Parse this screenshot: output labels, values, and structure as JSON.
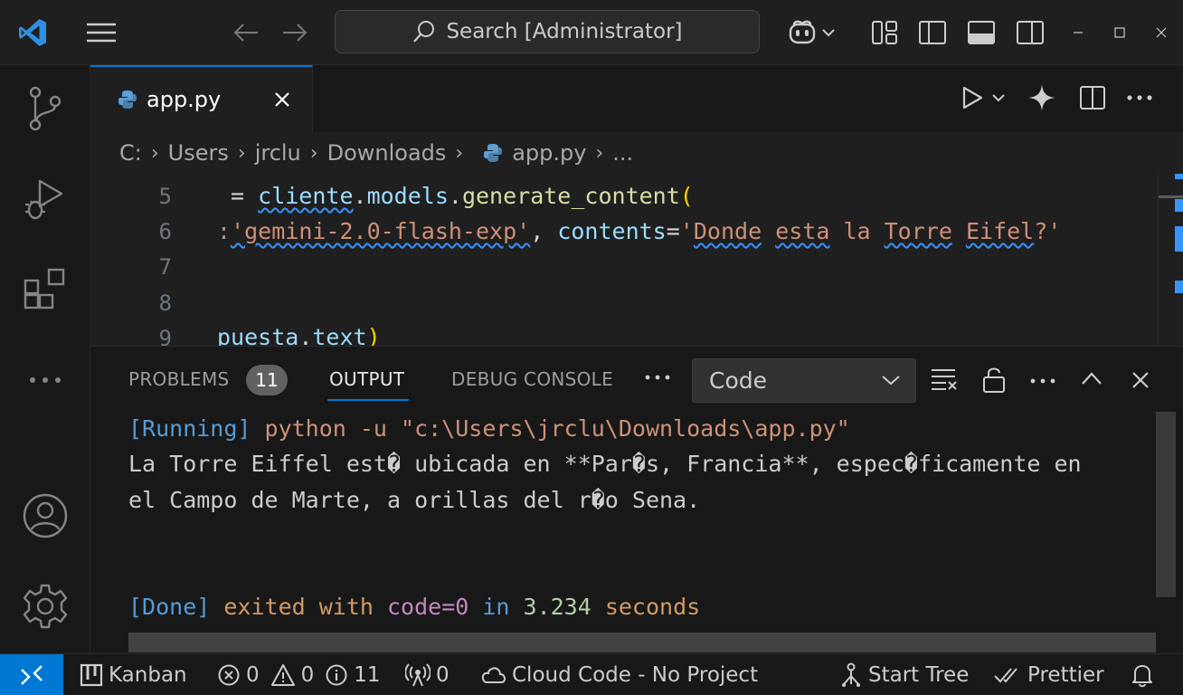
{
  "titlebar": {
    "search_text": "Search [Administrator]"
  },
  "tab": {
    "filename": "app.py"
  },
  "breadcrumb": [
    "C:",
    "Users",
    "jrclu",
    "Downloads",
    "app.py",
    "..."
  ],
  "editor": {
    "line_numbers": [
      "5",
      "6",
      "7",
      "8",
      "9"
    ],
    "line5": {
      "op": " = ",
      "obj": "cliente",
      "dot1": ".",
      "attr": "models",
      "dot2": ".",
      "fn": "generate_content",
      "paren": "("
    },
    "line6": {
      "lead": ":",
      "model": "'gemini-2.0-flash-exp'",
      "comma": ", ",
      "kw": "contents",
      "eq": "=",
      "q_open": "'",
      "w1": "Donde",
      "s1": " ",
      "w2": "esta",
      "s2": " la ",
      "w3": "Torre",
      "s3": " ",
      "w4": "Eifel",
      "q_close": "?'"
    },
    "line9": {
      "var": "puesta",
      "dot": ".",
      "attr": "text",
      "paren": ")"
    }
  },
  "panel": {
    "tabs": {
      "problems": "PROBLEMS",
      "output": "OUTPUT",
      "debug_console": "DEBUG CONSOLE"
    },
    "problems_count": "11",
    "output_channel": "Code",
    "output": {
      "running_tag": "[Running]",
      "running_cmd": " python -u \"c:\\Users\\jrclu\\Downloads\\app.py\"",
      "result_line1": "La Torre Eiffel est� ubicada en **Par�s, Francia**, espec�ficamente en",
      "result_line2": "el Campo de Marte, a orillas del r�o Sena.",
      "done_tag": "[Done]",
      "done_exited": " exited with ",
      "done_code": "code=0",
      "done_in": " in ",
      "done_time": "3.234",
      "done_seconds": " seconds"
    }
  },
  "statusbar": {
    "kanban": "Kanban",
    "errors": "0",
    "warnings": "0",
    "infos": "11",
    "ports": "0",
    "cloud_code": "Cloud Code - No Project",
    "start_tree": "Start Tree",
    "prettier": "Prettier"
  },
  "colors": {
    "accent": "#0078d4",
    "string": "#ce9178",
    "variable": "#9cdcfe",
    "function": "#dcdcaa",
    "running": "#569cd6",
    "exit_text": "#d19a66",
    "code_zero": "#c586c0",
    "number": "#b5cea8"
  }
}
